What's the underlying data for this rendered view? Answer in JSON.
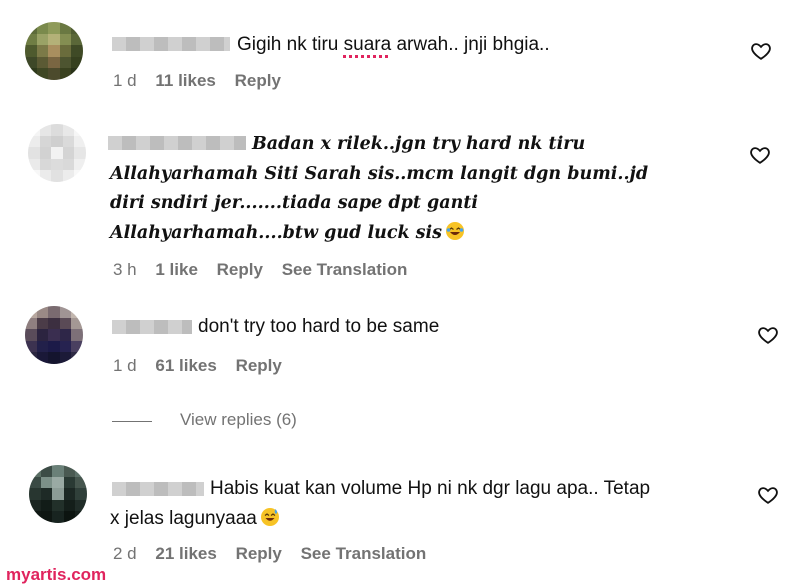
{
  "comments": [
    {
      "text": "Gigih nk tiru suara arwah.. jnji bhgia..",
      "text_parts": [
        "Gigih nk tiru ",
        "suara",
        " arwah.. jnji bhgia.."
      ],
      "time": "1 d",
      "likes": "11 likes",
      "reply": "Reply"
    },
    {
      "lines": [
        "Badan x rilek..jgn try hard nk tiru",
        "Allahyarhamah Siti Sarah sis..mcm langit dgn bumi..jd",
        "diri sndiri jer.......tiada sape dpt ganti",
        "Allahyarhamah....btw gud luck sis"
      ],
      "time": "3 h",
      "likes": "1 like",
      "reply": "Reply",
      "translation": "See Translation"
    },
    {
      "text": "don't try too hard to be same",
      "time": "1 d",
      "likes": "61 likes",
      "reply": "Reply"
    },
    {
      "lines": [
        "Habis kuat kan volume Hp ni nk dgr lagu apa.. Tetap",
        "x jelas lagunyaaa"
      ],
      "time": "2 d",
      "likes": "21 likes",
      "reply": "Reply",
      "translation": "See Translation"
    }
  ],
  "view_replies": "View replies (6)",
  "watermark": "myartis.com",
  "icons": {
    "like": "heart-icon",
    "laugh": "laughing-emoji-icon",
    "sweat": "sweat-smile-emoji-icon"
  },
  "colors": {
    "meta": "#737373",
    "text": "#111111",
    "watermark": "#e0245e"
  }
}
